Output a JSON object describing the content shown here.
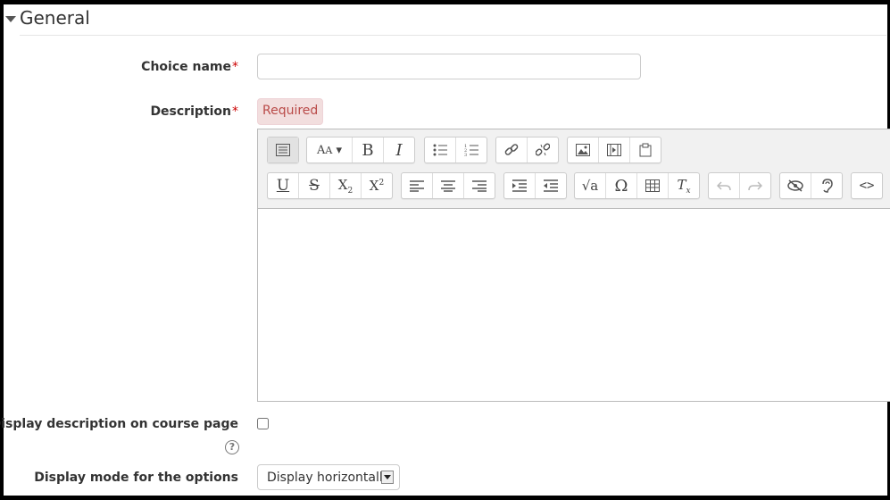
{
  "section": {
    "title": "General"
  },
  "fields": {
    "choice_name": {
      "label": "Choice name",
      "required_mark": "*",
      "value": ""
    },
    "description": {
      "label": "Description",
      "required_mark": "*",
      "error_badge": "Required"
    },
    "display_description": {
      "label": "Display description on course page",
      "help_icon": "?",
      "checked": false
    },
    "display_mode": {
      "label": "Display mode for the options",
      "selected": "Display horizontally"
    }
  },
  "toolbar": {
    "row1": [
      {
        "name": "toolbar-toggle",
        "glyph": "▤"
      },
      {
        "name": "font-style",
        "glyph": "A̲A▾"
      },
      {
        "name": "bold",
        "glyph": "B"
      },
      {
        "name": "italic",
        "glyph": "I"
      },
      {
        "name": "unordered-list",
        "glyph": "☰"
      },
      {
        "name": "ordered-list",
        "glyph": "⒈"
      },
      {
        "name": "link",
        "glyph": "🔗"
      },
      {
        "name": "unlink",
        "glyph": "⛓"
      },
      {
        "name": "image",
        "glyph": "▨"
      },
      {
        "name": "media",
        "glyph": "▦"
      },
      {
        "name": "file",
        "glyph": "📋"
      }
    ],
    "row2": [
      {
        "name": "underline",
        "glyph": "U"
      },
      {
        "name": "strikethrough",
        "glyph": "S"
      },
      {
        "name": "subscript",
        "glyph": "X₂"
      },
      {
        "name": "superscript",
        "glyph": "X²"
      },
      {
        "name": "align-left",
        "glyph": "≡"
      },
      {
        "name": "align-center",
        "glyph": "≡"
      },
      {
        "name": "align-right",
        "glyph": "≡"
      },
      {
        "name": "indent",
        "glyph": "⇥"
      },
      {
        "name": "outdent",
        "glyph": "⇤"
      },
      {
        "name": "equation",
        "glyph": "√a"
      },
      {
        "name": "special-char",
        "glyph": "Ω"
      },
      {
        "name": "table",
        "glyph": "▦"
      },
      {
        "name": "clear-format",
        "glyph": "Tx"
      },
      {
        "name": "undo",
        "glyph": "↶"
      },
      {
        "name": "redo",
        "glyph": "↷"
      },
      {
        "name": "accessibility-checker",
        "glyph": "◎"
      },
      {
        "name": "screenreader-helper",
        "glyph": "Ꝯ"
      },
      {
        "name": "html-source",
        "glyph": "<>"
      }
    ]
  }
}
